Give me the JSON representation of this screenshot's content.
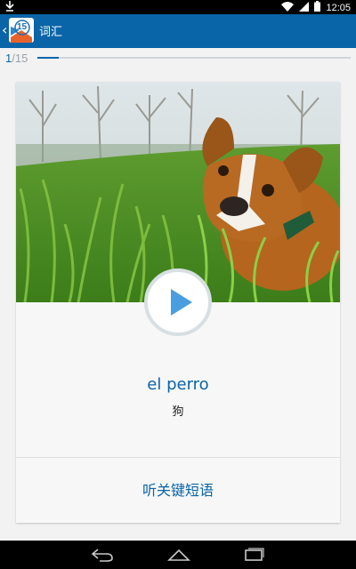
{
  "status_bar": {
    "time": "12:05",
    "icons": [
      "download-icon",
      "wifi-icon",
      "signal-icon",
      "battery-icon"
    ]
  },
  "action_bar": {
    "title": "词汇",
    "background": "#0a64a8",
    "logo_text": "15"
  },
  "progress": {
    "current": "1",
    "total": "/15",
    "fraction": 0.067
  },
  "card": {
    "image_description": "dog-in-grass",
    "word": "el perro",
    "translation": "狗",
    "key_phrase_label": "听关键短语"
  },
  "nav_bar": {
    "buttons": [
      "back-icon",
      "home-icon",
      "recents-icon"
    ]
  }
}
